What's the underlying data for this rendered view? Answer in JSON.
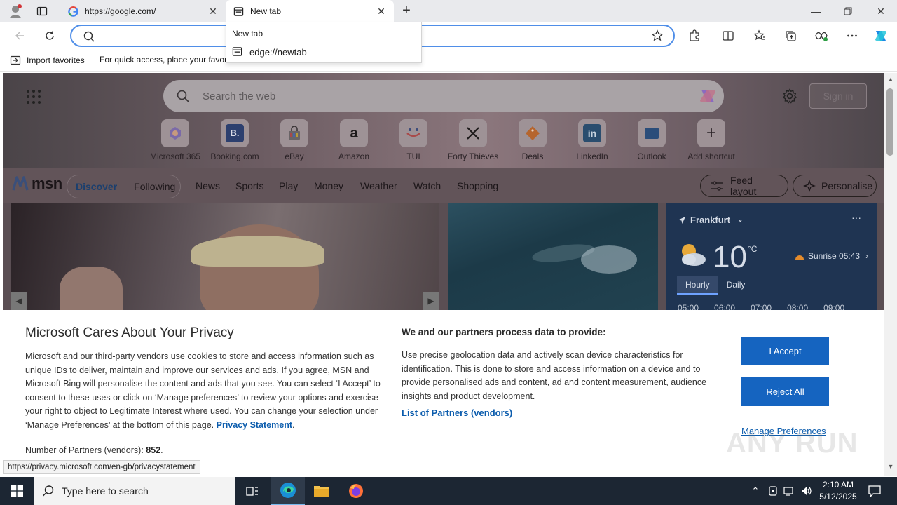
{
  "tabs": [
    {
      "title": "https://google.com/",
      "active": false
    },
    {
      "title": "New tab",
      "active": true
    }
  ],
  "new_tab_button": "+",
  "address_bar": {
    "value": "",
    "placeholder": ""
  },
  "dropdown": {
    "heading": "New tab",
    "suggestion": "edge://newtab"
  },
  "favorites_bar": {
    "import_label": "Import favorites",
    "hint": "For quick access, place your favori"
  },
  "msn": {
    "search_placeholder": "Search the web",
    "sign_in": "Sign in",
    "shortcuts": [
      {
        "label": "Microsoft 365",
        "color": "#a78fb0"
      },
      {
        "label": "Booking.com",
        "color": "#2c4a8a"
      },
      {
        "label": "eBay",
        "color": "#8e8a8c"
      },
      {
        "label": "Amazon",
        "color": "#a89fa2"
      },
      {
        "label": "TUI",
        "color": "#9aa7bd"
      },
      {
        "label": "Forty Thieves",
        "color": "#a09a9c"
      },
      {
        "label": "Deals",
        "color": "#c87a3c"
      },
      {
        "label": "LinkedIn",
        "color": "#2b5d8a"
      },
      {
        "label": "Outlook",
        "color": "#9aa6b8"
      },
      {
        "label": "Add shortcut",
        "color": "#9e9296"
      }
    ],
    "logo": "msn",
    "nav_pills": {
      "discover": "Discover",
      "following": "Following"
    },
    "nav_links": [
      "News",
      "Sports",
      "Play",
      "Money",
      "Weather",
      "Watch",
      "Shopping"
    ],
    "feed_layout": "Feed layout",
    "personalise": "Personalise",
    "weather": {
      "city": "Frankfurt",
      "temp": "10",
      "unit": "°C",
      "sunrise": "Sunrise 05:43",
      "tabs": [
        "Hourly",
        "Daily"
      ],
      "hours": [
        "05:00",
        "06:00",
        "07:00",
        "08:00",
        "09:00"
      ]
    }
  },
  "privacy": {
    "title": "Microsoft Cares About Your Privacy",
    "body": "Microsoft and our third-party vendors use cookies to store and access information such as unique IDs to deliver, maintain and improve our services and ads. If you agree, MSN and Microsoft Bing will personalise the content and ads that you see. You can select ‘I Accept’ to consent to these uses or click on ‘Manage preferences’ to review your options and exercise your right to object to Legitimate Interest where used.  You can change your selection under ‘Manage Preferences’ at the bottom of this page.",
    "privacy_link": "Privacy Statement",
    "partners_count_label": "Number of Partners (vendors):",
    "partners_count": "852",
    "purpose_heading": "We and our partners process data to provide:",
    "purpose_text": "Use precise geolocation data and actively scan device characteristics for identification. This is done to store and access information on a device and to provide personalised ads and content, ad and content measurement, audience insights and product development.",
    "partners_link": "List of Partners (vendors)",
    "accept": "I Accept",
    "reject": "Reject All",
    "manage": "Manage Preferences"
  },
  "status_url": "https://privacy.microsoft.com/en-gb/privacystatement",
  "watermark": "ANY RUN",
  "taskbar": {
    "search_placeholder": "Type here to search",
    "time": "2:10 AM",
    "date": "5/12/2025"
  },
  "colors": {
    "accent": "#1564c0",
    "link": "#0b5cad",
    "taskbar": "#1c2633"
  }
}
